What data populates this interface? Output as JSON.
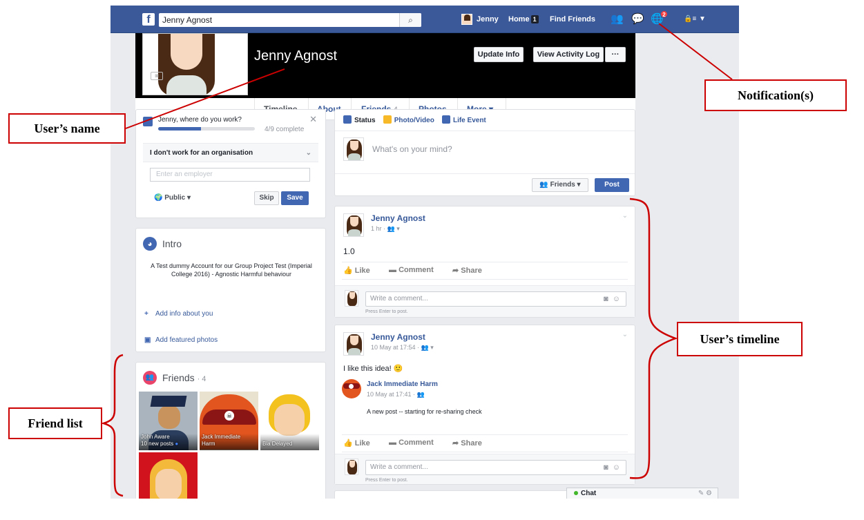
{
  "topbar": {
    "logo": "f",
    "search_value": "Jenny Agnost",
    "user_label": "Jenny",
    "home_label": "Home",
    "home_count": "1",
    "find_friends_label": "Find Friends",
    "notifications_count": "2"
  },
  "profile": {
    "name": "Jenny Agnost",
    "update_info_label": "Update Info",
    "activity_log_label": "View Activity Log",
    "more_actions_label": "···"
  },
  "tabs": {
    "timeline": "Timeline",
    "about": "About",
    "friends": "Friends",
    "friends_count": "4",
    "photos": "Photos",
    "more": "More ▾"
  },
  "work_card": {
    "question": "Jenny, where do you work?",
    "progress_label": "4/9 complete",
    "progress_fraction": 0.444,
    "selected_option": "I don't work for an organisation",
    "employer_placeholder": "Enter an employer",
    "privacy_label": "Public ▾",
    "skip_label": "Skip",
    "save_label": "Save"
  },
  "intro": {
    "title": "Intro",
    "bio": "A Test dummy Account for our Group Project Test (Imperial College 2016) - Agnostic Harmful behaviour",
    "add_info_label": "Add info about you",
    "add_photos_label": "Add featured photos"
  },
  "friends": {
    "title": "Friends",
    "count": "· 4",
    "items": [
      {
        "name": "John Aware",
        "sub": "10 new posts"
      },
      {
        "name": "Jack Immediate Harm",
        "sub": ""
      },
      {
        "name": "Bla Delayed",
        "sub": ""
      },
      {
        "name": "",
        "sub": ""
      }
    ]
  },
  "composer": {
    "tab_status": "Status",
    "tab_photo": "Photo/Video",
    "tab_life": "Life Event",
    "placeholder": "What's on your mind?",
    "audience_label": "Friends ▾",
    "post_label": "Post"
  },
  "posts": [
    {
      "author": "Jenny Agnost",
      "meta": "1 hr · 👥 ▾",
      "text": "1.0",
      "like": "Like",
      "comment": "Comment",
      "share": "Share",
      "comment_placeholder": "Write a comment...",
      "hint": "Press Enter to post."
    },
    {
      "author": "Jenny Agnost",
      "meta": "10 May at 17:54 · 👥 ▾",
      "text": "I like this idea! 🙂",
      "shared_author": "Jack Immediate Harm",
      "shared_meta": "10 May at 17:41 · 👥",
      "shared_text": "A new post -- starting for re-sharing check",
      "like": "Like",
      "comment": "Comment",
      "share": "Share",
      "comment_placeholder": "Write a comment...",
      "hint": "Press Enter to post."
    }
  ],
  "chat": {
    "label": "Chat"
  },
  "annotations": {
    "user_name": "User’s name",
    "notifications": "Notification(s)",
    "timeline": "User’s timeline",
    "friend_list": "Friend list"
  },
  "colors": {
    "brand": "#3b5998",
    "link": "#365899",
    "annotation": "#cc0000"
  }
}
